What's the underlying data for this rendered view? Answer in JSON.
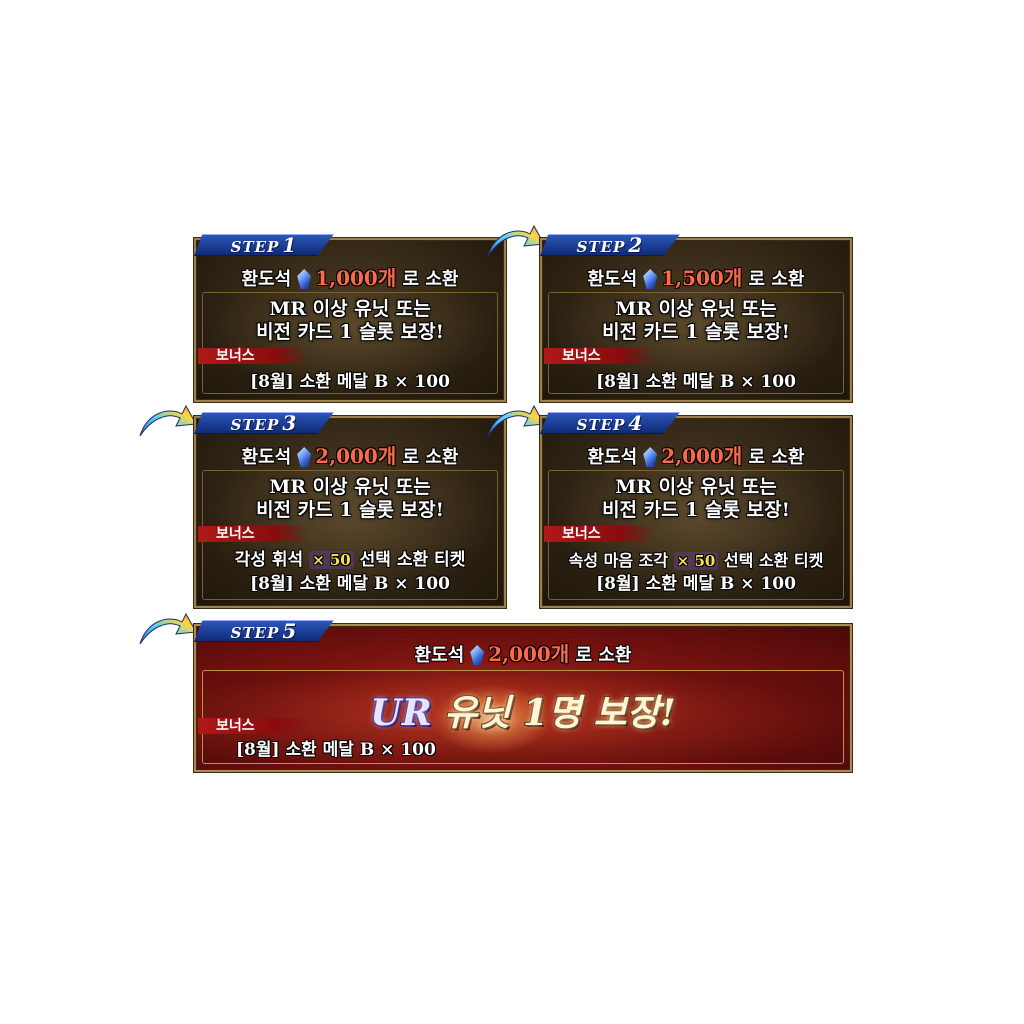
{
  "steps": [
    {
      "label": "STEP",
      "number": "1",
      "cost_prefix": "환도석",
      "cost_amount": "1,000개",
      "cost_suffix": "로 소환",
      "guarantee_line1": "MR 이상 유닛 또는",
      "guarantee_line2": "비전 카드 1 슬롯 보장!",
      "bonus_label": "보너스",
      "bonus_line1": "[8월] 소환 메달 B × 100"
    },
    {
      "label": "STEP",
      "number": "2",
      "cost_prefix": "환도석",
      "cost_amount": "1,500개",
      "cost_suffix": "로 소환",
      "guarantee_line1": "MR 이상 유닛 또는",
      "guarantee_line2": "비전 카드 1 슬롯 보장!",
      "bonus_label": "보너스",
      "bonus_line1": "[8월] 소환 메달 B × 100"
    },
    {
      "label": "STEP",
      "number": "3",
      "cost_prefix": "환도석",
      "cost_amount": "2,000개",
      "cost_suffix": "로 소환",
      "guarantee_line1": "MR 이상 유닛 또는",
      "guarantee_line2": "비전 카드 1 슬롯 보장!",
      "bonus_label": "보너스",
      "bonus_item_a": "각성 휘석",
      "bonus_item_mult": "× 50",
      "bonus_item_b": "선택 소환 티켓",
      "bonus_line2": "[8월] 소환 메달 B × 100"
    },
    {
      "label": "STEP",
      "number": "4",
      "cost_prefix": "환도석",
      "cost_amount": "2,000개",
      "cost_suffix": "로 소환",
      "guarantee_line1": "MR 이상 유닛 또는",
      "guarantee_line2": "비전 카드 1 슬롯 보장!",
      "bonus_label": "보너스",
      "bonus_item_a": "속성 마음 조각",
      "bonus_item_mult": "× 50",
      "bonus_item_b": "선택 소환 티켓",
      "bonus_line2": "[8월] 소환 메달 B × 100"
    },
    {
      "label": "STEP",
      "number": "5",
      "cost_prefix": "환도석",
      "cost_amount": "2,000개",
      "cost_suffix": "로 소환",
      "ur_prefix": "UR",
      "ur_text": "유닛 1명 보장!",
      "bonus_label": "보너스",
      "bonus_line1": "[8월] 소환 메달 B × 100"
    }
  ],
  "icons": {
    "currency": "crystal-gem-icon",
    "progress": "curved-arrow-icon"
  },
  "colors": {
    "step_tab": "#1f44a8",
    "amount": "#ff6a4a",
    "panel_dark": "#2e2313",
    "panel_red": "#7c1410",
    "bonus_tag": "#b01818"
  }
}
